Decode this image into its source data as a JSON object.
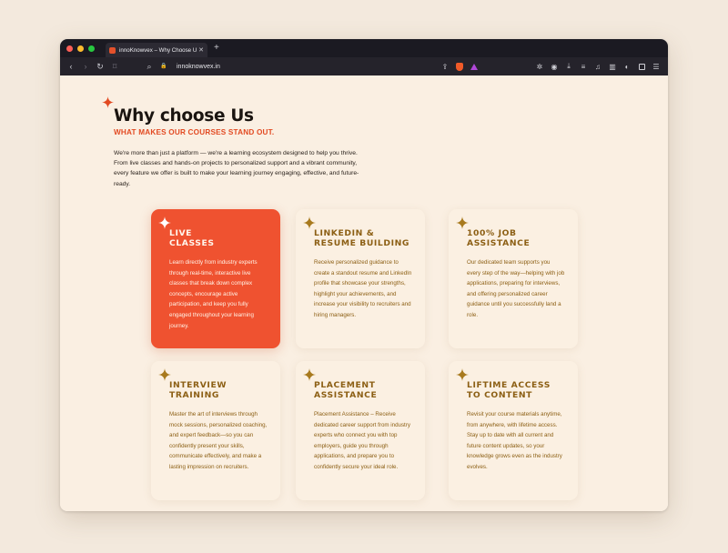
{
  "browser": {
    "tab_title": "innoKnowvex – Why Choose Us",
    "tab_close": "✕",
    "new_tab": "+",
    "url": "innoknowvex.in",
    "traffic_lights": [
      "#ff5f57",
      "#febc2e",
      "#28c840"
    ]
  },
  "toolbar": {
    "back": "‹",
    "forward": "›",
    "reload": "↻",
    "bookmark": "⌑",
    "search": "⌕",
    "lock": "🔒",
    "share": "⇪",
    "extensions": "✲",
    "camera": "◉",
    "download": "⤓",
    "reading": "≡",
    "music": "♫",
    "sidebar": "▥",
    "wallet": "◐",
    "menu": "☰"
  },
  "section": {
    "heading": "Why choose Us",
    "subheading": "WHAT MAKES OUR COURSES STAND OUT.",
    "intro": "We're more than just a platform — we're a learning ecosystem designed to help you thrive. From live classes and hands-on projects to personalized support and a vibrant community, every feature we offer is built to make your learning journey engaging, effective, and future-ready."
  },
  "cards": [
    {
      "title_line1": "LIVE",
      "title_line2": "CLASSES",
      "text": "Learn directly from industry experts through real-time, interactive live classes that break down complex concepts, encourage active participation, and keep you fully engaged throughout your learning journey."
    },
    {
      "title_line1": "LINKEDIN &",
      "title_line2": "RESUME BUILDING",
      "text": "Receive personalized guidance to create a standout resume and LinkedIn profile that showcase your strengths, highlight your achievements, and increase your visibility to recruiters and hiring managers."
    },
    {
      "title_line1": "100% JOB",
      "title_line2": "ASSISTANCE",
      "text": "Our dedicated team supports you every step of the way—helping with job applications, preparing for interviews, and offering personalized career guidance until you successfully land a role."
    },
    {
      "title_line1": "INTERVIEW",
      "title_line2": "TRAINING",
      "text": "Master the art of interviews through mock sessions, personalized coaching, and expert feedback—so you can confidently present your skills, communicate effectively, and make a lasting impression on recruiters."
    },
    {
      "title_line1": "PLACEMENT",
      "title_line2": "ASSISTANCE",
      "text": "Placement Assistance – Receive dedicated career support from industry experts who connect you with top employers, guide you through applications, and prepare you to confidently secure your ideal role."
    },
    {
      "title_line1": "LIFTIME ACCESS",
      "title_line2": "TO CONTENT",
      "text": "Revisit your course materials anytime, from anywhere, with lifetime access. Stay up to date with all current and future content updates, so your knowledge grows even as the industry evolves."
    }
  ],
  "colors": {
    "accent_orange": "#ef5230",
    "subheading_red": "#e24a22",
    "card_text_gold": "#8c5f14",
    "page_bg": "#faefe2",
    "sparkle_gold": "#a87a1e"
  }
}
